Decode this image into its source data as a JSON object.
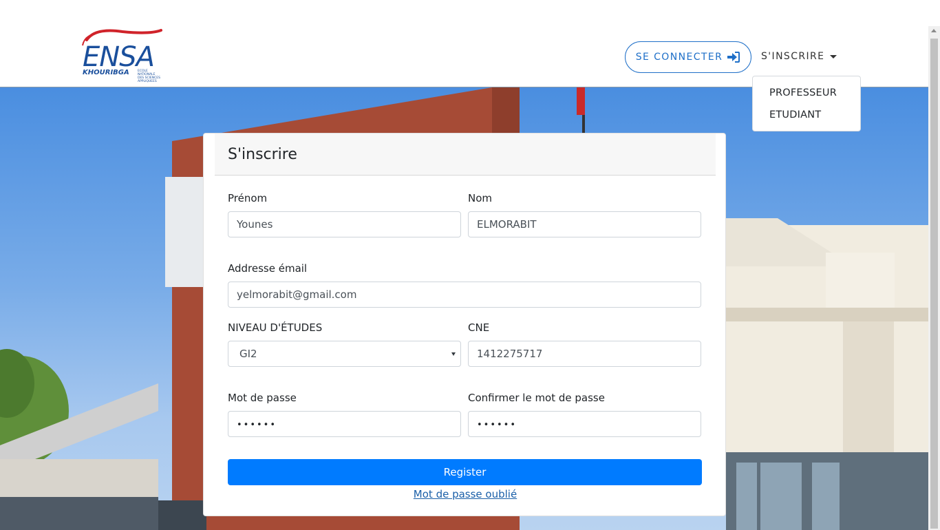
{
  "brand": {
    "logo_main": "ENSA",
    "logo_city": "KHOURIBGA",
    "logo_sub_lines": [
      "ECOLE",
      "NATIONALE",
      "DES SCIENCES",
      "APPLIQUEES"
    ]
  },
  "nav": {
    "login_label": "SE CONNECTER",
    "login_icon": "sign-in-icon",
    "signup_label": "S'INSCRIRE",
    "dropdown_items": [
      "PROFESSEUR",
      "ETUDIANT"
    ]
  },
  "form": {
    "title": "S'inscrire",
    "first_name": {
      "label": "Prénom",
      "value": "Younes"
    },
    "last_name": {
      "label": "Nom",
      "value": "ELMORABIT"
    },
    "email": {
      "label": "Addresse émail",
      "value": "yelmorabit@gmail.com"
    },
    "level": {
      "label": "NIVEAU D'ÉTUDES",
      "value": "GI2"
    },
    "cne": {
      "label": "CNE",
      "value": "1412275717"
    },
    "password": {
      "label": "Mot de passe",
      "value": "••••••"
    },
    "confirm_password": {
      "label": "Confirmer le mot de passe",
      "value": "••••••"
    },
    "submit_label": "Register",
    "forgot_label": "Mot de passe oublié"
  },
  "colors": {
    "primary": "#007bff",
    "login_border": "#1e6fc8",
    "logo_blue": "#1a4f9c",
    "logo_red": "#d0232a"
  }
}
